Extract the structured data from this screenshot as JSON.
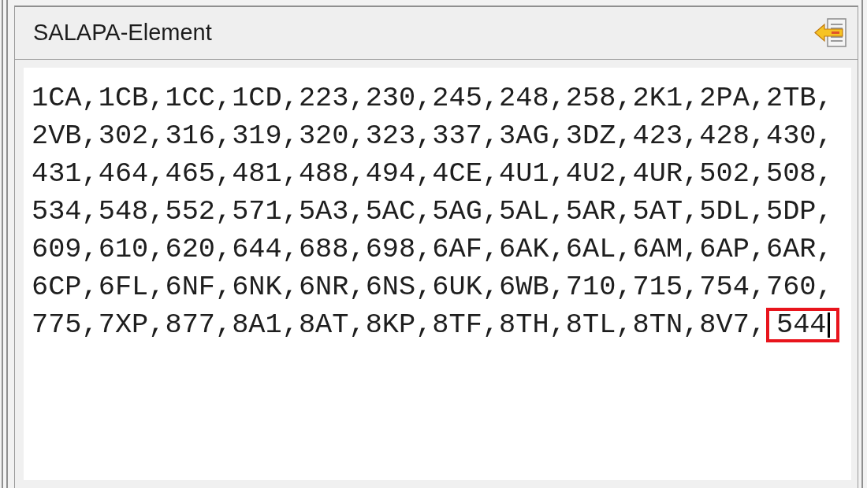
{
  "panel": {
    "title": "SALAPA-Element",
    "text_area": {
      "lines": [
        "1CA,1CB,1CC,1CD,223,230,245,248,258,2K1,2PA,2TB,",
        "2VB,302,316,319,320,323,337,3AG,3DZ,423,428,430,",
        "431,464,465,481,488,494,4CE,4U1,4U2,4UR,502,508,",
        "534,548,552,571,5A3,5AC,5AG,5AL,5AR,5AT,5DL,5DP,",
        "609,610,620,644,688,698,6AF,6AK,6AL,6AM,6AP,6AR,",
        "6CP,6FL,6NF,6NK,6NR,6NS,6UK,6WB,710,715,754,760,",
        "775,7XP,877,8A1,8AT,8KP,8TF,8TH,8TL,8TN,8V7,"
      ],
      "highlighted_entry": {
        "text": "544",
        "outlined": true
      },
      "caret_visible": true
    }
  }
}
